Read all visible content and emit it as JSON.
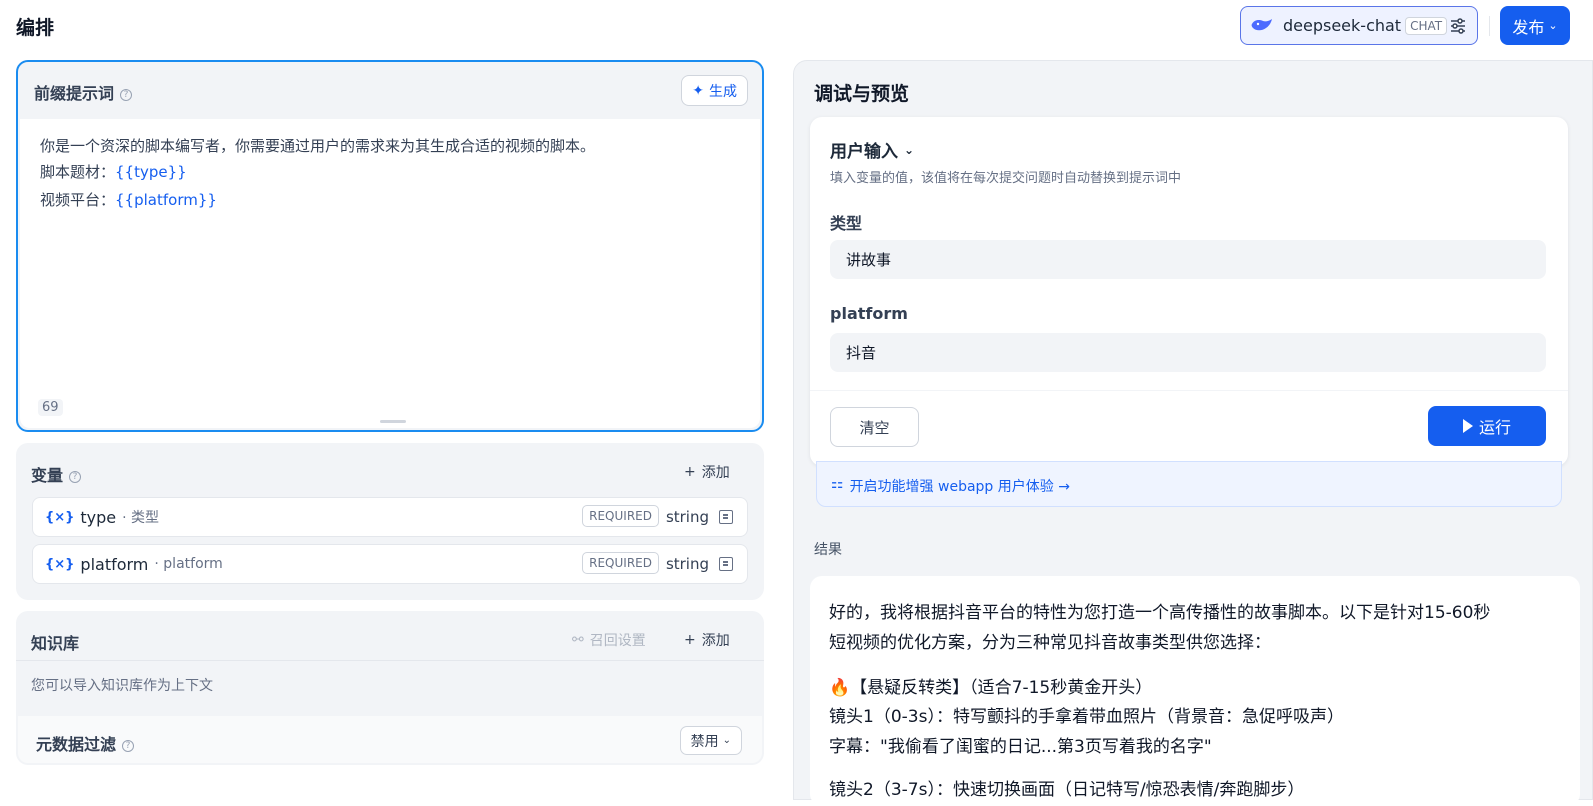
{
  "header": {
    "title": "编排",
    "model_name": "deepseek-chat",
    "model_badge": "CHAT",
    "publish_label": "发布"
  },
  "prompt": {
    "title": "前缀提示词",
    "generate_label": "生成",
    "line1": "你是一个资深的脚本编写者，你需要通过用户的需求来为其生成合适的视频的脚本。",
    "line2_label": "脚本题材：",
    "line2_var": "{{type}}",
    "line3_label": "视频平台：",
    "line3_var": "{{platform}}",
    "char_count": "69"
  },
  "variables": {
    "title": "变量",
    "add_label": "添加",
    "items": [
      {
        "icon": "{×}",
        "name": "type",
        "label": "· 类型",
        "required": "REQUIRED",
        "type": "string"
      },
      {
        "icon": "{×}",
        "name": "platform",
        "label": "· platform",
        "required": "REQUIRED",
        "type": "string"
      }
    ]
  },
  "knowledge": {
    "title": "知识库",
    "recall_label": "召回设置",
    "add_label": "添加",
    "hint": "您可以导入知识库作为上下文",
    "meta_title": "元数据过滤",
    "meta_value": "禁用"
  },
  "preview": {
    "title": "调试与预览",
    "user_input_title": "用户输入",
    "user_input_hint": "填入变量的值，该值将在每次提交问题时自动替换到提示词中",
    "fields": [
      {
        "label": "类型",
        "value": "讲故事"
      },
      {
        "label": "platform",
        "value": "抖音"
      }
    ],
    "clear_label": "清空",
    "run_label": "运行",
    "enhance_label": "开启功能增强 webapp 用户体验 →",
    "result_label": "结果",
    "result_lines": [
      "好的，我将根据抖音平台的特性为您打造一个高传播性的故事脚本。以下是针对15-60秒",
      "短视频的优化方案，分为三种常见抖音故事类型供您选择：",
      "🔥【悬疑反转类】（适合7-15秒黄金开头）",
      "镜头1（0-3s）：特写颤抖的手拿着带血照片（背景音：急促呼吸声）",
      "字幕：\"我偷看了闺蜜的日记...第3页写着我的名字\"",
      "镜头2（3-7s）：快速切换画面（日记特写/惊恐表情/奔跑脚步）"
    ]
  },
  "colors": {
    "accent": "#155eef",
    "focus_border": "#1a8cf0",
    "panel_bg": "#f2f4f7"
  }
}
